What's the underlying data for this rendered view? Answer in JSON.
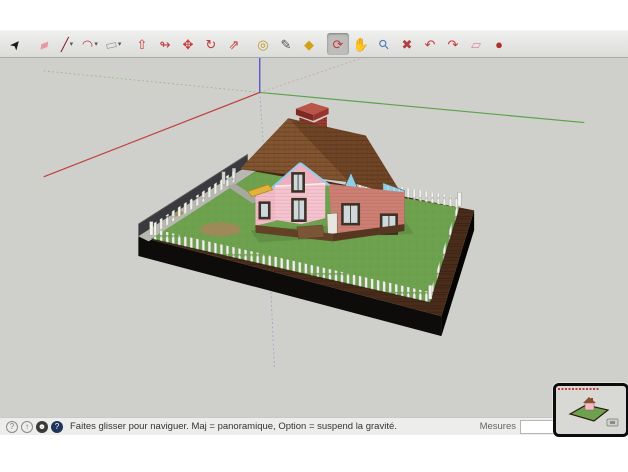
{
  "window": {
    "app": "SketchUp",
    "active_tool": "orbit"
  },
  "toolbar": {
    "tools": [
      {
        "name": "select",
        "glyph": "➤",
        "color": "#1a1a1a",
        "rot": -50,
        "caret": false,
        "active": false
      },
      {
        "name": "eraser",
        "glyph": "▰",
        "color": "#e89aa4",
        "rot": -20,
        "caret": false,
        "active": false
      },
      {
        "name": "line",
        "glyph": "╱",
        "color": "#7a2020",
        "rot": 0,
        "caret": true,
        "active": false
      },
      {
        "name": "arc",
        "glyph": "◠",
        "color": "#c23a3a",
        "rot": 15,
        "caret": true,
        "active": false
      },
      {
        "name": "rectangle",
        "glyph": "▭",
        "color": "#9a9a96",
        "rot": -12,
        "caret": true,
        "active": false
      },
      {
        "name": "push-pull",
        "glyph": "⇧",
        "color": "#c23a3a",
        "rot": 0,
        "caret": false,
        "active": false
      },
      {
        "name": "follow-me",
        "glyph": "↬",
        "color": "#c23a3a",
        "rot": 0,
        "caret": false,
        "active": false
      },
      {
        "name": "move",
        "glyph": "✥",
        "color": "#c23a3a",
        "rot": 0,
        "caret": false,
        "active": false
      },
      {
        "name": "rotate",
        "glyph": "↻",
        "color": "#c23a3a",
        "rot": 0,
        "caret": false,
        "active": false
      },
      {
        "name": "scale",
        "glyph": "⇗",
        "color": "#c23a3a",
        "rot": 0,
        "caret": false,
        "active": false
      },
      {
        "name": "tape-measure",
        "glyph": "◎",
        "color": "#b99a28",
        "rot": 0,
        "caret": false,
        "active": false
      },
      {
        "name": "text",
        "glyph": "✎",
        "color": "#55504a",
        "rot": 0,
        "caret": false,
        "active": false
      },
      {
        "name": "paint-bucket",
        "glyph": "◆",
        "color": "#d4a017",
        "rot": 0,
        "caret": false,
        "active": false
      },
      {
        "name": "orbit",
        "glyph": "⟳",
        "color": "#c23a3a",
        "rot": 0,
        "caret": false,
        "active": true
      },
      {
        "name": "pan",
        "glyph": "✋",
        "color": "#caa36a",
        "rot": 0,
        "caret": false,
        "active": false
      },
      {
        "name": "zoom",
        "glyph": "⚲",
        "color": "#4a7ab5",
        "rot": -45,
        "caret": false,
        "active": false
      },
      {
        "name": "zoom-extents",
        "glyph": "✖",
        "color": "#b04040",
        "rot": 0,
        "caret": false,
        "active": false
      },
      {
        "name": "previous-view",
        "glyph": "↶",
        "color": "#c23a3a",
        "rot": 0,
        "caret": false,
        "active": false
      },
      {
        "name": "next-view",
        "glyph": "↷",
        "color": "#c23a3a",
        "rot": 0,
        "caret": false,
        "active": false
      },
      {
        "name": "section-plane",
        "glyph": "▱",
        "color": "#d98a9a",
        "rot": 0,
        "caret": false,
        "active": false
      },
      {
        "name": "model-info",
        "glyph": "●",
        "color": "#b03030",
        "rot": 0,
        "caret": false,
        "active": false
      }
    ]
  },
  "status": {
    "message": "Faites glisser pour naviguer. Maj = panoramique, Option =  suspend la gravité.",
    "icons": [
      {
        "name": "help-circle",
        "glyph": "?",
        "style": "outline"
      },
      {
        "name": "geolocation-circle",
        "glyph": "↑",
        "style": "outline"
      },
      {
        "name": "credits-circle",
        "glyph": "☻",
        "style": "filldark"
      },
      {
        "name": "instructor-circle",
        "glyph": "?",
        "style": "fillnavy"
      }
    ]
  },
  "measures": {
    "label": "Mesures",
    "value": "",
    "placeholder": ""
  },
  "scene": {
    "description": "pink cottage with brown gabled roof and brick chimney on fenced green lawn platform",
    "components": [
      "drawing-axes",
      "lawn-platform",
      "picket-fence",
      "back-wall",
      "house",
      "dirt-patches",
      "walkway"
    ]
  },
  "palette": {
    "viewport_bg": "#cfcfcb",
    "statusbar_bg": "#ededeb",
    "axis_red": "#c24040",
    "axis_green": "#5aa34a",
    "axis_blue": "#4444cc",
    "grass": "#6da14e",
    "platform_brown": "#4a2c1a",
    "platform_side": "#0e0c0a",
    "concrete": "#b8b8b2",
    "wall_dark": "#3a3a3e",
    "fence_white": "#f2f2ec",
    "roof": "#82542f",
    "roof_dark": "#6f4526",
    "chimney": "#9e3a2e",
    "pink": "#f3bac7",
    "salmon": "#cd7f73",
    "gable_pink": "#eeafbf",
    "trim_blue": "#9cc9e9",
    "teal": "#8ecfe6",
    "foundation": "#634126",
    "awning": "#e2b33c"
  }
}
